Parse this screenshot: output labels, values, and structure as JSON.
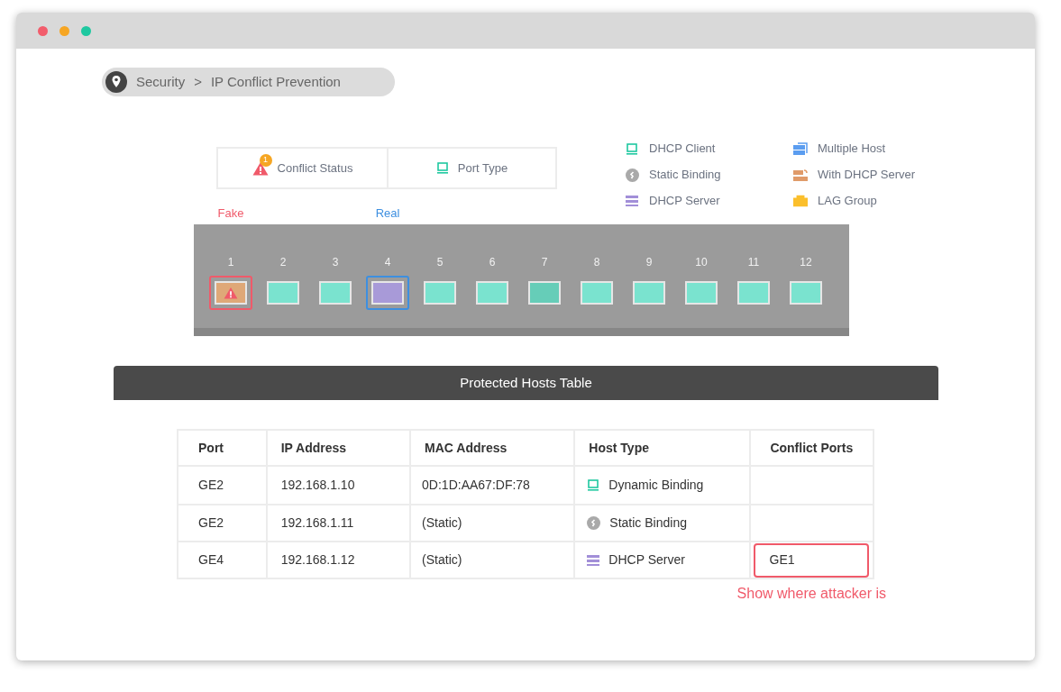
{
  "breadcrumb": {
    "section": "Security",
    "separator": ">",
    "page": "IP Conflict Prevention"
  },
  "view_tabs": [
    {
      "label": "Conflict Status",
      "kind": "warning",
      "badge": "1"
    },
    {
      "label": "Port Type",
      "kind": "laptop"
    }
  ],
  "legend": [
    {
      "label": "DHCP Client",
      "kind": "laptop"
    },
    {
      "label": "Static Binding",
      "kind": "link"
    },
    {
      "label": "DHCP Server",
      "kind": "server"
    },
    {
      "label": "Multiple Host",
      "kind": "multi"
    },
    {
      "label": "With DHCP Server",
      "kind": "router"
    },
    {
      "label": "LAG Group",
      "kind": "lag"
    }
  ],
  "ports": [
    {
      "number": "1",
      "color": "#dfa878",
      "alert": true,
      "tag": {
        "text": "Fake",
        "kind": "fake"
      }
    },
    {
      "number": "2",
      "color": "#7ae3cf",
      "alert": false
    },
    {
      "number": "3",
      "color": "#7ae3cf",
      "alert": false
    },
    {
      "number": "4",
      "color": "#a89ad8",
      "alert": false,
      "tag": {
        "text": "Real",
        "kind": "real"
      }
    },
    {
      "number": "5",
      "color": "#7ae3cf",
      "alert": false
    },
    {
      "number": "6",
      "color": "#7ae3cf",
      "alert": false
    },
    {
      "number": "7",
      "color": "#66cdb8",
      "alert": false
    },
    {
      "number": "8",
      "color": "#7ae3cf",
      "alert": false
    },
    {
      "number": "9",
      "color": "#7ae3cf",
      "alert": false
    },
    {
      "number": "10",
      "color": "#7ae3cf",
      "alert": false
    },
    {
      "number": "11",
      "color": "#7ae3cf",
      "alert": false
    },
    {
      "number": "12",
      "color": "#7ae3cf",
      "alert": false
    }
  ],
  "table": {
    "title": "Protected Hosts Table",
    "columns": [
      "Port",
      "IP Address",
      "MAC Address",
      "Host Type",
      "Conflict Ports"
    ],
    "rows": [
      {
        "port": "GE2",
        "ip": "192.168.1.10",
        "mac": "0D:1D:AA67:DF:78",
        "host_type": {
          "label": "Dynamic Binding",
          "kind": "laptop"
        }
      },
      {
        "port": "GE2",
        "ip": "192.168.1.11",
        "mac": "(Static)",
        "host_type": {
          "label": "Static Binding",
          "kind": "link"
        }
      },
      {
        "port": "GE4",
        "ip": "192.168.1.12",
        "mac": "(Static)",
        "host_type": {
          "label": "DHCP Server",
          "kind": "server"
        },
        "conflict": "GE1"
      }
    ]
  },
  "note": "Show where attacker is"
}
